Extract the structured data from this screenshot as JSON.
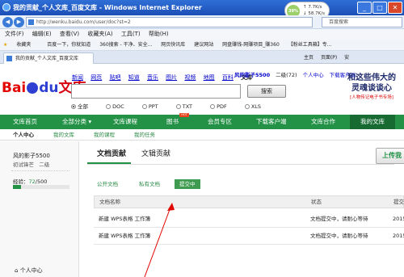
{
  "window": {
    "title": "我的贡献_个人文库_百度文库 - Windows Internet Explorer",
    "buttons": [
      "_",
      "□",
      "✕"
    ]
  },
  "network": {
    "percent": "39%",
    "up": "7.7K/s",
    "down": "58.7K/s"
  },
  "address": {
    "url": "http://wenku.baidu.com/user/doc?st=2",
    "search_placeholder": "百度搜索"
  },
  "menu": [
    "文件(F)",
    "编辑(E)",
    "查看(V)",
    "收藏夹(A)",
    "工具(T)",
    "帮助(H)"
  ],
  "favorites": [
    "收藏夹",
    "百度一下，你就知道",
    "360搜索 - 干净、安全...",
    "网页快讯库",
    "建议网站",
    "网盘赚钱-网赚项目_赚360",
    "【粉丝工具箱】专..."
  ],
  "tab": {
    "label": "我的贡献_个人文库_百度文库"
  },
  "tabtools": [
    "主页",
    "页面(P)",
    "安"
  ],
  "site": {
    "logo": {
      "bai": "Bai",
      "du": "du",
      "wenku": "文库"
    },
    "topnav": [
      "新闻",
      "网页",
      "贴吧",
      "知道",
      "音乐",
      "图片",
      "视频",
      "地图",
      "百科",
      "文库"
    ],
    "topnav_current": "文库",
    "user": {
      "name": "风的影子5500",
      "level": "二级(72)",
      "center": "个人中心",
      "download": "下载客户端"
    },
    "search_button": "搜索",
    "filters": [
      "全部",
      "DOC",
      "PPT",
      "TXT",
      "PDF",
      "XLS"
    ],
    "ad": {
      "line1": "和这些伟大的",
      "line2": "灵魂谈谈心",
      "line3": "[人物传记电子书专场]"
    }
  },
  "mainnav": [
    "文库首页",
    "全部分类 ▾",
    "文库课程",
    "图书",
    "会员专区",
    "下载客户端",
    "文库合作",
    "我的文库"
  ],
  "mainnav_hot": "HOT",
  "subnav": [
    "个人中心",
    "我的文库",
    "我的课程",
    "我的任务"
  ],
  "sidebar": {
    "name": "风的影子5500",
    "rank": "初试锋芒",
    "level": "二级",
    "exp_label": "经验：",
    "exp_value": "72",
    "exp_max": "/500",
    "exp_fraction": 0.144,
    "center": "个人中心"
  },
  "content": {
    "tabs": [
      "文档贡献",
      "文辑贡献"
    ],
    "upload": "上传我",
    "filters": [
      "公开文档",
      "私有文档",
      "提交中"
    ],
    "columns": [
      "文档名称",
      "状态",
      "提交"
    ],
    "rows": [
      {
        "name": "新建 WPS表格 工作簿",
        "status": "文档提交中，请耐心等待",
        "date": "2015"
      },
      {
        "name": "新建 WPS表格 工作簿",
        "status": "文档提交中，请耐心等待",
        "date": "2015"
      }
    ]
  },
  "colors": {
    "green": "#239247",
    "dark_green": "#176b32",
    "title_blue": "#1b4fb6",
    "link": "#0000cc",
    "red_arrow": "#e10602"
  }
}
